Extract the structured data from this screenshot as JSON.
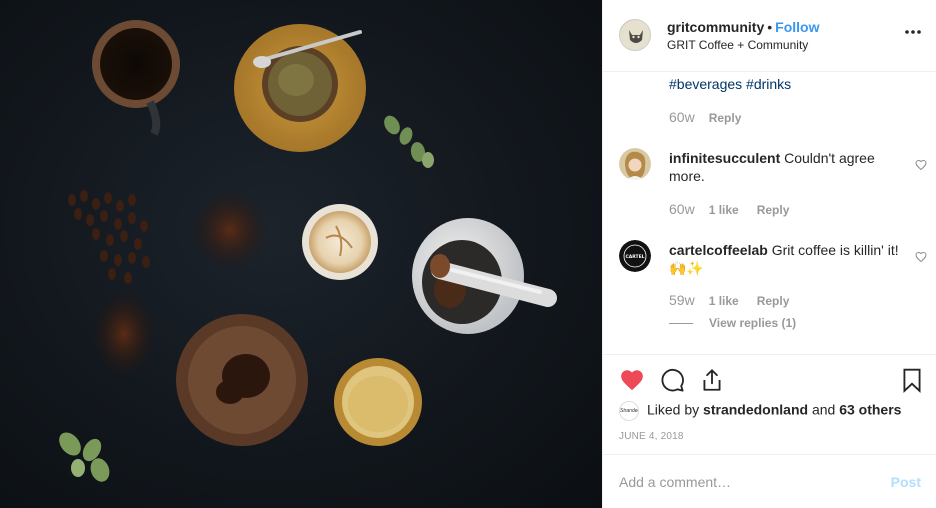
{
  "post": {
    "image_alt": "Flat-lay of coffee cups, beans, grounds and a mortar and pestle on a dark surface"
  },
  "header": {
    "username": "gritcommunity",
    "separator": "•",
    "follow_label": "Follow",
    "subtitle": "GRIT Coffee + Community"
  },
  "comments": [
    {
      "text": "#beverages #drinks",
      "age": "60w",
      "reply_label": "Reply"
    },
    {
      "username": "infinitesucculent",
      "text": "Couldn't agree more.",
      "age": "60w",
      "likes": "1 like",
      "reply_label": "Reply"
    },
    {
      "username": "cartelcoffeelab",
      "text": "Grit coffee is killin' it! 🙌✨",
      "age": "59w",
      "likes": "1 like",
      "reply_label": "Reply",
      "view_replies": "View replies (1)"
    }
  ],
  "likes": {
    "prefix": "Liked by ",
    "user": "strandedonland",
    "middle": " and ",
    "others": "63 others"
  },
  "date": "JUNE 4, 2018",
  "add_comment": {
    "placeholder": "Add a comment…",
    "post_label": "Post"
  },
  "colors": {
    "accent_blue": "#3897f0",
    "heart_red": "#ed4956",
    "muted_text": "#999999",
    "post_disabled": "#b2dffc"
  },
  "icons": [
    "more-icon",
    "heart-filled-icon",
    "comment-icon",
    "share-icon",
    "bookmark-icon",
    "heart-outline-icon"
  ]
}
